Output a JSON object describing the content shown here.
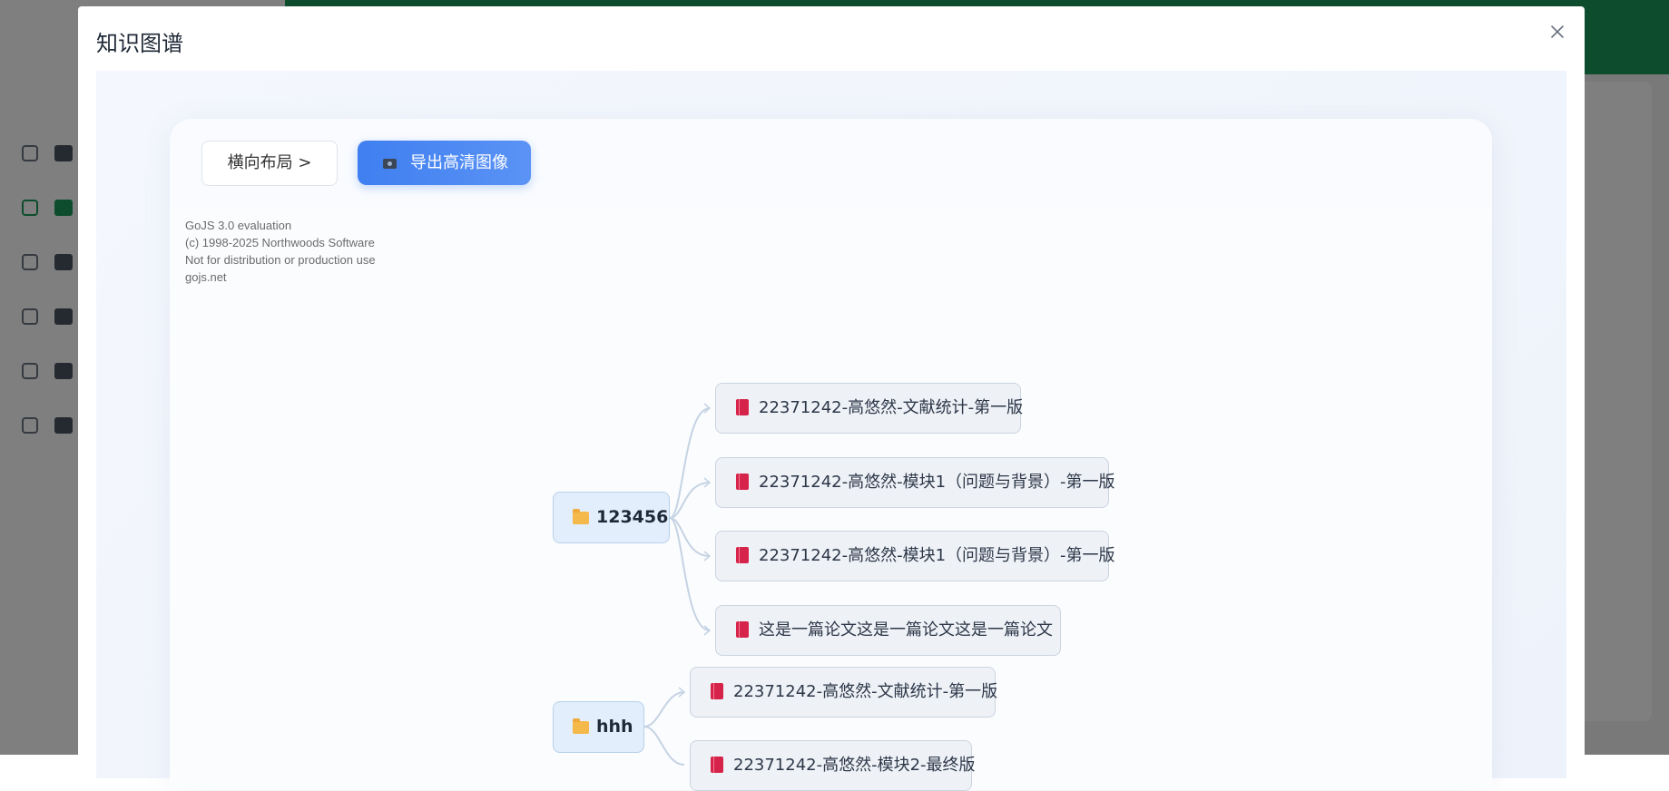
{
  "modal": {
    "title": "知识图谱",
    "close_label": "×"
  },
  "toolbar": {
    "layout_label": "横向布局 >",
    "export_label": "导出高清图像"
  },
  "watermark": [
    "GoJS 3.0 evaluation",
    "(c) 1998-2025 Northwoods Software",
    "Not for distribution or production use",
    "gojs.net"
  ],
  "graph": {
    "groups": [
      {
        "name": "123456",
        "papers": [
          "22371242-高悠然-文献统计-第一版",
          "22371242-高悠然-模块1（问题与背景）-第一版",
          "22371242-高悠然-模块1（问题与背景）-第一版",
          "这是一篇论文这是一篇论文这是一篇论文"
        ]
      },
      {
        "name": "hhh",
        "papers": [
          "22371242-高悠然-文献统计-第一版",
          "22371242-高悠然-模块2-最终版"
        ]
      }
    ]
  },
  "colors": {
    "primary": "#3f7ff0",
    "brand_green": "#1a9a5c",
    "paper_icon": "#d6234a",
    "folder_icon": "#f5b84a",
    "link": "#c5d3e3"
  }
}
